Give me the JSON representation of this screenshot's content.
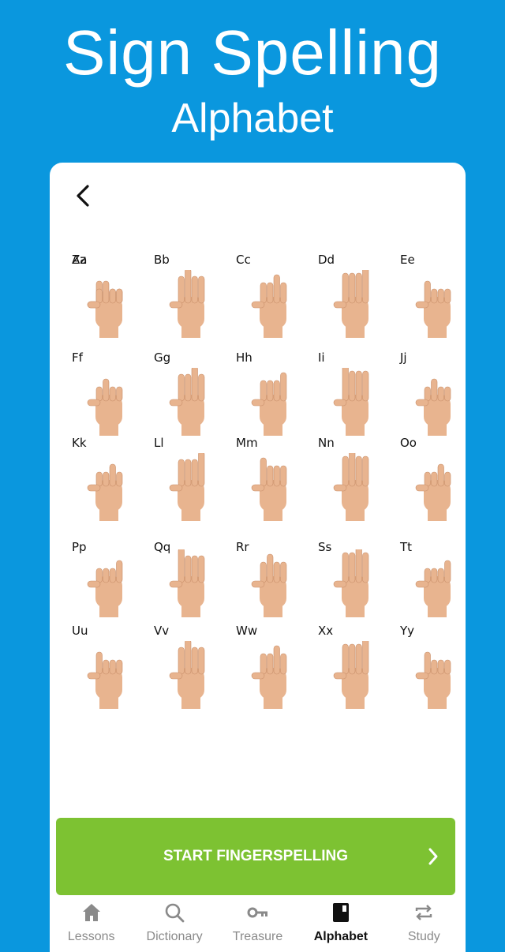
{
  "promo": {
    "title": "Sign Spelling",
    "subtitle": "Alphabet"
  },
  "alphabet": [
    {
      "label": "Aa",
      "icon": "hand-sign-a-icon"
    },
    {
      "label": "Bb",
      "icon": "hand-sign-b-icon"
    },
    {
      "label": "Cc",
      "icon": "hand-sign-c-icon"
    },
    {
      "label": "Dd",
      "icon": "hand-sign-d-icon"
    },
    {
      "label": "Ee",
      "icon": "hand-sign-e-icon"
    },
    {
      "label": "Ff",
      "icon": "hand-sign-f-icon"
    },
    {
      "label": "Gg",
      "icon": "hand-sign-g-icon"
    },
    {
      "label": "Hh",
      "icon": "hand-sign-h-icon"
    },
    {
      "label": "Ii",
      "icon": "hand-sign-i-icon"
    },
    {
      "label": "Jj",
      "icon": "hand-sign-j-icon"
    },
    {
      "label": "Kk",
      "icon": "hand-sign-k-icon"
    },
    {
      "label": "Ll",
      "icon": "hand-sign-l-icon"
    },
    {
      "label": "Mm",
      "icon": "hand-sign-m-icon"
    },
    {
      "label": "Nn",
      "icon": "hand-sign-n-icon"
    },
    {
      "label": "Oo",
      "icon": "hand-sign-o-icon"
    },
    {
      "label": "Pp",
      "icon": "hand-sign-p-icon"
    },
    {
      "label": "Qq",
      "icon": "hand-sign-q-icon"
    },
    {
      "label": "Rr",
      "icon": "hand-sign-r-icon"
    },
    {
      "label": "Ss",
      "icon": "hand-sign-s-icon"
    },
    {
      "label": "Tt",
      "icon": "hand-sign-t-icon"
    },
    {
      "label": "Uu",
      "icon": "hand-sign-u-icon"
    },
    {
      "label": "Vv",
      "icon": "hand-sign-v-icon"
    },
    {
      "label": "Ww",
      "icon": "hand-sign-w-icon"
    },
    {
      "label": "Xx",
      "icon": "hand-sign-x-icon"
    },
    {
      "label": "Yy",
      "icon": "hand-sign-y-icon"
    },
    {
      "label": "Zz",
      "icon": "hand-sign-z-icon"
    }
  ],
  "cta": {
    "label": "START FINGERSPELLING",
    "icon": "chevron-right-icon"
  },
  "tabs": [
    {
      "label": "Lessons",
      "icon": "home-icon",
      "active": false
    },
    {
      "label": "Dictionary",
      "icon": "search-icon",
      "active": false
    },
    {
      "label": "Treasure",
      "icon": "key-icon",
      "active": false
    },
    {
      "label": "Alphabet",
      "icon": "book-icon",
      "active": true
    },
    {
      "label": "Study",
      "icon": "repeat-icon",
      "active": false
    }
  ],
  "colors": {
    "background": "#0a97de",
    "accent": "#7dc232",
    "skin": "#e8b48f"
  }
}
